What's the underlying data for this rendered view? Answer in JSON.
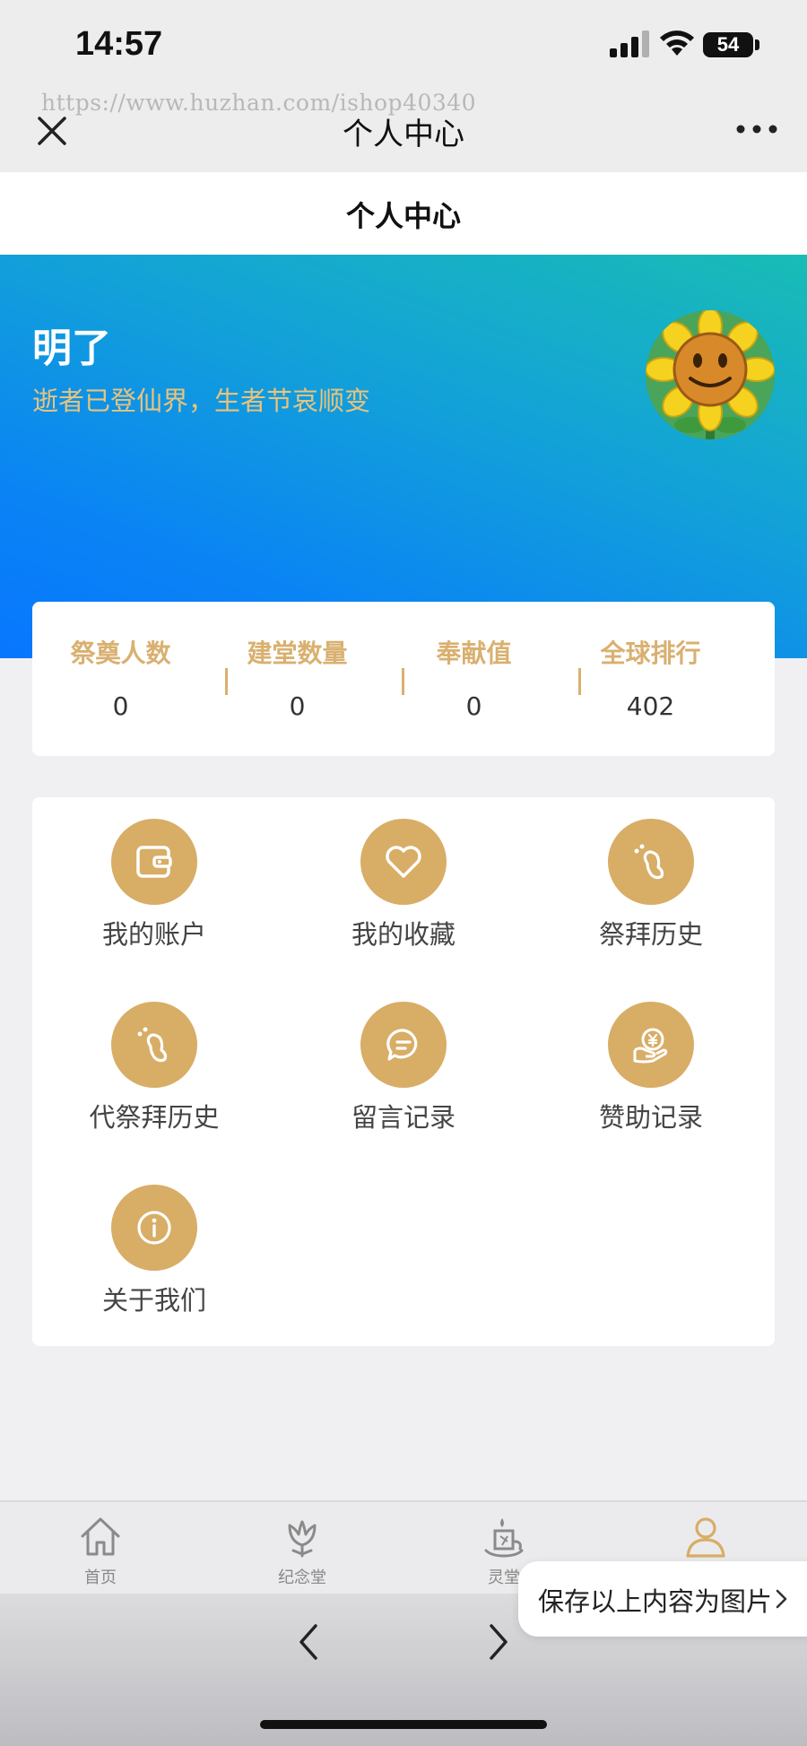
{
  "status_bar": {
    "time": "14:57",
    "battery": "54",
    "icons": [
      "signal-icon",
      "wifi-icon",
      "battery-icon"
    ]
  },
  "nav_bar": {
    "watermark": "https://www.huzhan.com/ishop40340",
    "title": "个人中心",
    "icons": [
      "close-icon",
      "more-icon"
    ]
  },
  "page_header": {
    "title": "个人中心"
  },
  "profile": {
    "name": "明了",
    "motto": "逝者已登仙界，生者节哀顺变",
    "avatar": "sunflower-avatar"
  },
  "stats": [
    {
      "label": "祭奠人数",
      "value": "0"
    },
    {
      "label": "建堂数量",
      "value": "0"
    },
    {
      "label": "奉献值",
      "value": "0"
    },
    {
      "label": "全球排行",
      "value": "402"
    }
  ],
  "menu": [
    {
      "label": "我的账户",
      "icon": "wallet-icon"
    },
    {
      "label": "我的收藏",
      "icon": "heart-icon"
    },
    {
      "label": "祭拜历史",
      "icon": "footprint-icon"
    },
    {
      "label": "代祭拜历史",
      "icon": "footprint-icon"
    },
    {
      "label": "留言记录",
      "icon": "chat-bubble-icon"
    },
    {
      "label": "赞助记录",
      "icon": "yen-hand-icon"
    },
    {
      "label": "关于我们",
      "icon": "info-icon"
    }
  ],
  "tab_bar": [
    {
      "label": "首页",
      "icon": "home-icon"
    },
    {
      "label": "纪念堂",
      "icon": "flower-icon"
    },
    {
      "label": "灵堂",
      "icon": "candle-icon"
    },
    {
      "label": "",
      "icon": "user-icon",
      "active": true
    }
  ],
  "save_toast": {
    "label": "保存以上内容为图片"
  },
  "colors": {
    "accent_gold": "#d8ad66",
    "hero_gradient_start": "#19bcb5",
    "hero_gradient_end": "#0876ff"
  }
}
